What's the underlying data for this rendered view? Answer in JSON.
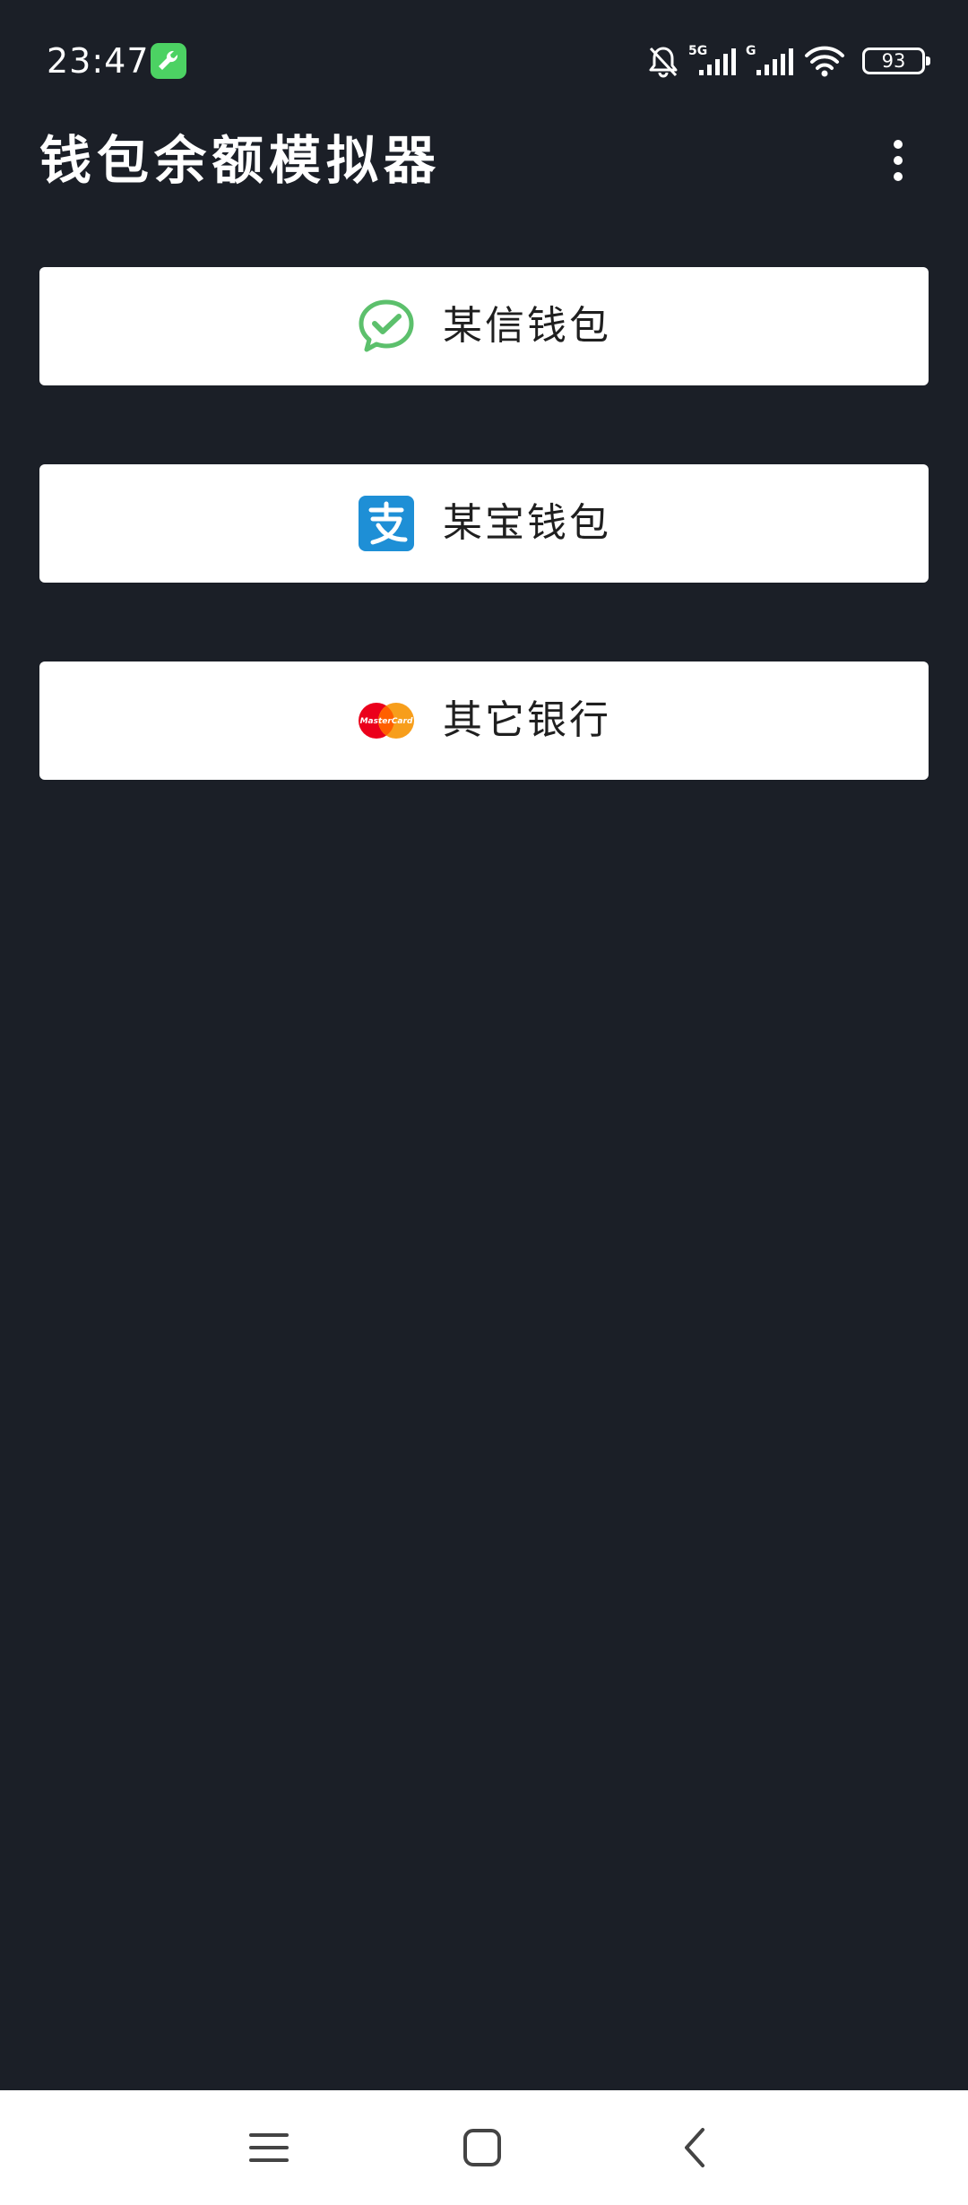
{
  "status_bar": {
    "time": "23:47",
    "network_5g": "5G",
    "network_g": "G",
    "battery": "93",
    "icons": [
      "wrench-app-icon",
      "bell-off-icon",
      "signal-5g-icon",
      "signal-g-icon",
      "wifi-icon",
      "battery-icon"
    ]
  },
  "app_bar": {
    "title": "钱包余额模拟器",
    "menu_icon": "more-vert-icon"
  },
  "wallets": [
    {
      "label": "某信钱包",
      "icon": "wechat-icon",
      "accent": "#5cc06c"
    },
    {
      "label": "某宝钱包",
      "icon": "alipay-icon",
      "accent": "#1e8fd6"
    },
    {
      "label": "其它银行",
      "icon": "mastercard-icon",
      "accent": "#eb001b"
    }
  ],
  "mastercard_text": "MasterCard",
  "nav_bar": {
    "buttons": [
      "menu-icon",
      "home-icon",
      "back-icon"
    ]
  },
  "colors": {
    "background": "#1b1f27",
    "card": "#ffffff",
    "status_app_icon": "#4cd263"
  }
}
